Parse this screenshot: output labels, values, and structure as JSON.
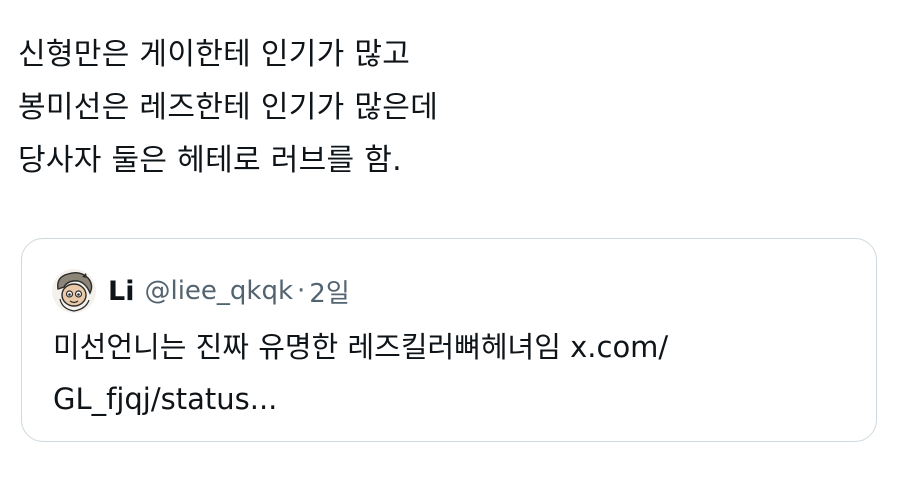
{
  "tweet": {
    "text_lines": [
      "신형만은 게이한테 인기가 많고",
      "봉미선은 레즈한테 인기가 많은데",
      "당사자 둘은 헤테로 러브를 함."
    ]
  },
  "quote": {
    "avatar_icon": "cartoon-avatar-icon",
    "display_name": "Li",
    "handle": "@liee_qkqk",
    "separator": "·",
    "age": "2일",
    "text_lines": [
      "미선언니는 진짜 유명한 레즈킬러뼈헤녀임 x.com/",
      "GL_fjqj/status..."
    ]
  },
  "colors": {
    "text": "#0f1419",
    "secondary": "#536471",
    "border": "#cfd9de"
  }
}
